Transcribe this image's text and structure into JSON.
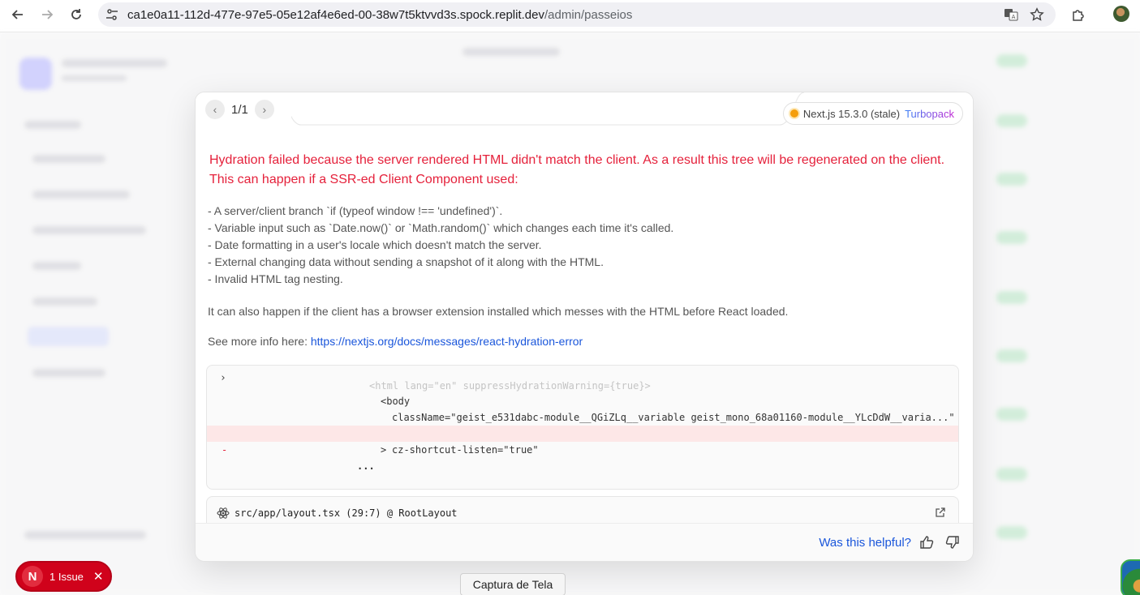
{
  "browser": {
    "url_host": "ca1e0a11-112d-477e-97e5-05e12af4e6ed-00-38w7t5ktvvd3s.spock.replit.dev",
    "url_path": "/admin/passeios"
  },
  "dialog": {
    "pager": "1/1",
    "version_label": "Next.js 15.3.0 (stale)",
    "bundler_label": "Turbopack",
    "error_title": "Hydration failed because the server rendered HTML didn't match the client. As a result this tree will be regenerated on the client. This can happen if a SSR-ed Client Component used:",
    "bullets": [
      "- A server/client branch `if (typeof window !== 'undefined')`.",
      "- Variable input such as `Date.now()` or `Math.random()` which changes each time it's called.",
      "- Date formatting in a user's locale which doesn't match the server.",
      "- External changing data without sending a snapshot of it along with the HTML.",
      "- Invalid HTML tag nesting."
    ],
    "extension_note": "It can also happen if the client has a browser extension installed which messes with the HTML before React loaded.",
    "more_info_prefix": "See more info here: ",
    "more_info_link": "https://nextjs.org/docs/messages/react-hydration-error",
    "diff": {
      "faded_line": "<html lang=\"en\" suppressHydrationWarning={true}>",
      "body_open": "<body",
      "class_line": "className=\"geist_e531dabc-module__QGiZLq__variable geist_mono_68a01160-module__YLcDdW__varia...\"",
      "removed_marker": "-",
      "removed_line": "cz-shortcut-listen=\"true\"",
      "close": ">",
      "ellipsis": "..."
    },
    "source_location": "src/app/layout.tsx (29:7) @ RootLayout",
    "helpful_label": "Was this helpful?"
  },
  "issues_badge": {
    "initial": "N",
    "label": "1 Issue"
  },
  "screenshot_button": "Captura de Tela"
}
